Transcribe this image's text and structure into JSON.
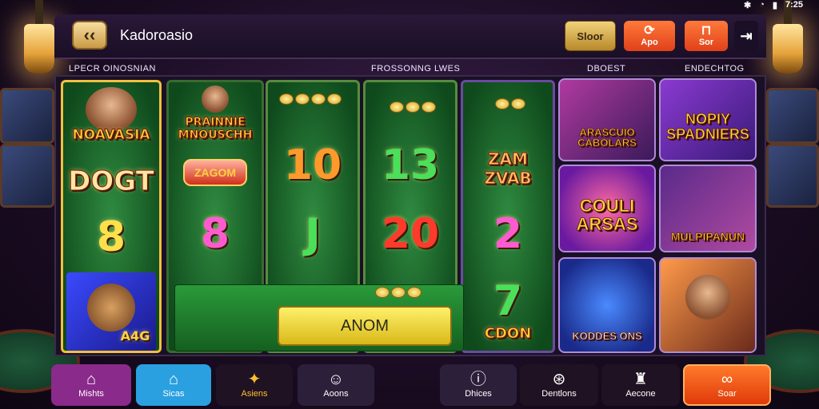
{
  "status_bar": {
    "time": "7:25"
  },
  "header": {
    "back_icon": "back-arrow-icon",
    "title": "Kadoroasio",
    "shop_label": "Sloor",
    "app_label": "Apo",
    "sub_label": "Sor",
    "menu_icon": "menu-icon"
  },
  "sections": {
    "promotions": "LPECR OINOSNIAN",
    "featured": "FROSSONNG LWES",
    "deposit": "DBOEST",
    "encoding": "ENDECHTOG"
  },
  "reels": [
    {
      "top_label": "NOAVASIA",
      "mid_label": "DOGT",
      "number": "8",
      "bottom_label": "A4G"
    },
    {
      "top_label": "PRAINNIE MNOUSCHH",
      "mid_label": "ZAGOM",
      "number": "8"
    },
    {
      "number_top": "10",
      "number_bottom": "J"
    },
    {
      "number_top": "13",
      "number_bottom": "20"
    },
    {
      "top_label": "ZAM ZVAB",
      "number_top": "2",
      "number_bottom": "7",
      "bottom_label": "CDON"
    }
  ],
  "action_button": "ANOM",
  "game_tiles": [
    {
      "label": "ARASCUIO CABOLARS"
    },
    {
      "label": "NOPIY SPADNIERS"
    },
    {
      "label": "COULI ARSAS"
    },
    {
      "label": "MULPIPANUN"
    },
    {
      "label": "KODDES ONS"
    },
    {
      "label": ""
    }
  ],
  "bottom_nav": [
    {
      "label": "Mishts",
      "icon": "home-icon",
      "color": "#8a2a8a"
    },
    {
      "label": "Sicas",
      "icon": "house-icon",
      "color": "#2aa0e0"
    },
    {
      "label": "Asiens",
      "icon": "pets-icon",
      "color": "#2a1a2a"
    },
    {
      "label": "Aoons",
      "icon": "chat-icon",
      "color": "#3a2a4a"
    },
    {
      "label": "Dhices",
      "icon": "info-icon",
      "color": "#3a2a4a"
    },
    {
      "label": "Dentlons",
      "icon": "target-icon",
      "color": "#2a1a2a"
    },
    {
      "label": "Aecone",
      "icon": "person-icon",
      "color": "#2a1a2a"
    },
    {
      "label": "Soar",
      "icon": "infinity-icon",
      "color": "#ff5a1a"
    }
  ]
}
